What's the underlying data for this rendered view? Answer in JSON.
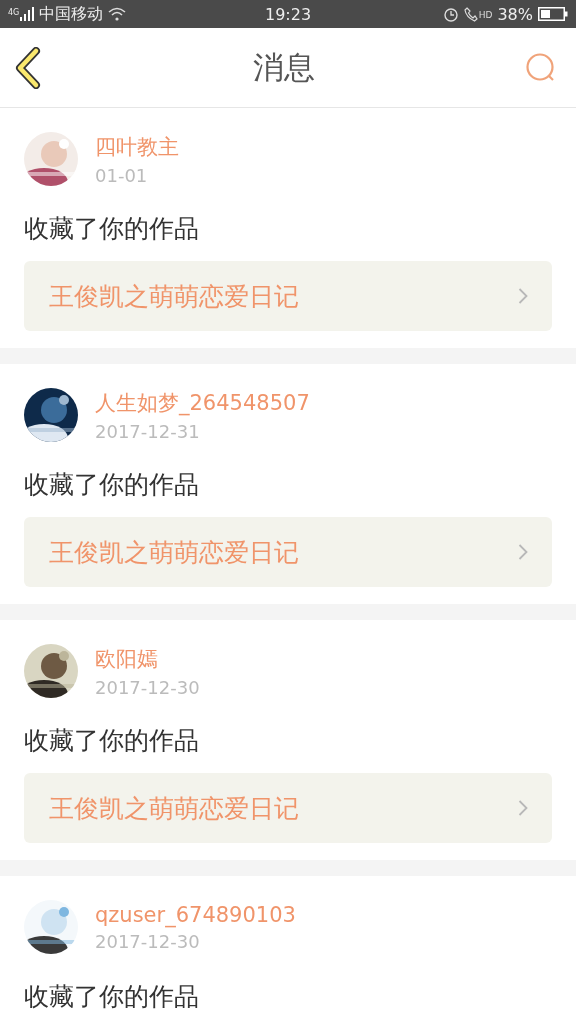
{
  "status_bar": {
    "network": "4G",
    "carrier": "中国移动",
    "time": "19:23",
    "call_badge": "HD",
    "battery": "38%"
  },
  "header": {
    "title": "消息"
  },
  "messages": [
    {
      "user": "四叶教主",
      "date": "01-01",
      "action": "收藏了你的作品",
      "work": "王俊凯之萌萌恋爱日记"
    },
    {
      "user": "人生如梦_264548507",
      "date": "2017-12-31",
      "action": "收藏了你的作品",
      "work": "王俊凯之萌萌恋爱日记"
    },
    {
      "user": "欧阳嫣",
      "date": "2017-12-30",
      "action": "收藏了你的作品",
      "work": "王俊凯之萌萌恋爱日记"
    },
    {
      "user": "qzuser_674890103",
      "date": "2017-12-30",
      "action": "收藏了你的作品"
    }
  ]
}
